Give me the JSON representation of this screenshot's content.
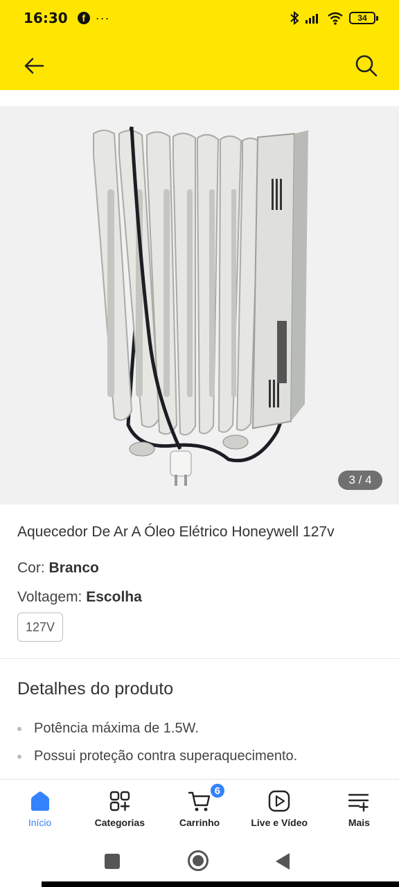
{
  "status_bar": {
    "time": "16:30",
    "facebook_glyph": "f",
    "notification_dots": "···",
    "battery_level": "34",
    "icons": [
      "facebook-icon",
      "bluetooth-icon",
      "signal-icon",
      "wifi-icon",
      "battery-icon"
    ]
  },
  "header": {
    "background_color": "#ffe600",
    "back_icon": "arrow-left-icon",
    "search_icon": "search-icon"
  },
  "gallery": {
    "counter": "3 / 4",
    "current_index": 3,
    "total": 4
  },
  "product": {
    "title": "Aquecedor De Ar A Óleo Elétrico Honeywell 127v",
    "color_label": "Cor:",
    "color_value": "Branco",
    "voltage_label": "Voltagem:",
    "voltage_value": "Escolha",
    "voltage_option": "127V"
  },
  "details": {
    "title": "Detalhes do produto",
    "items": [
      "Potência máxima de 1.5W.",
      "Possui proteção contra superaquecimento."
    ]
  },
  "bottom_nav": {
    "accent_color": "#3483fa",
    "items": [
      {
        "label": "Início",
        "icon": "home-icon",
        "active": true
      },
      {
        "label": "Categorias",
        "icon": "categories-icon",
        "active": false
      },
      {
        "label": "Carrinho",
        "icon": "cart-icon",
        "active": false,
        "badge": "6"
      },
      {
        "label": "Live e Vídeo",
        "icon": "play-video-icon",
        "active": false
      },
      {
        "label": "Mais",
        "icon": "menu-plus-icon",
        "active": false
      }
    ]
  },
  "system_nav": {
    "icons": [
      "recent-apps-icon",
      "home-circle-icon",
      "back-triangle-icon"
    ]
  }
}
